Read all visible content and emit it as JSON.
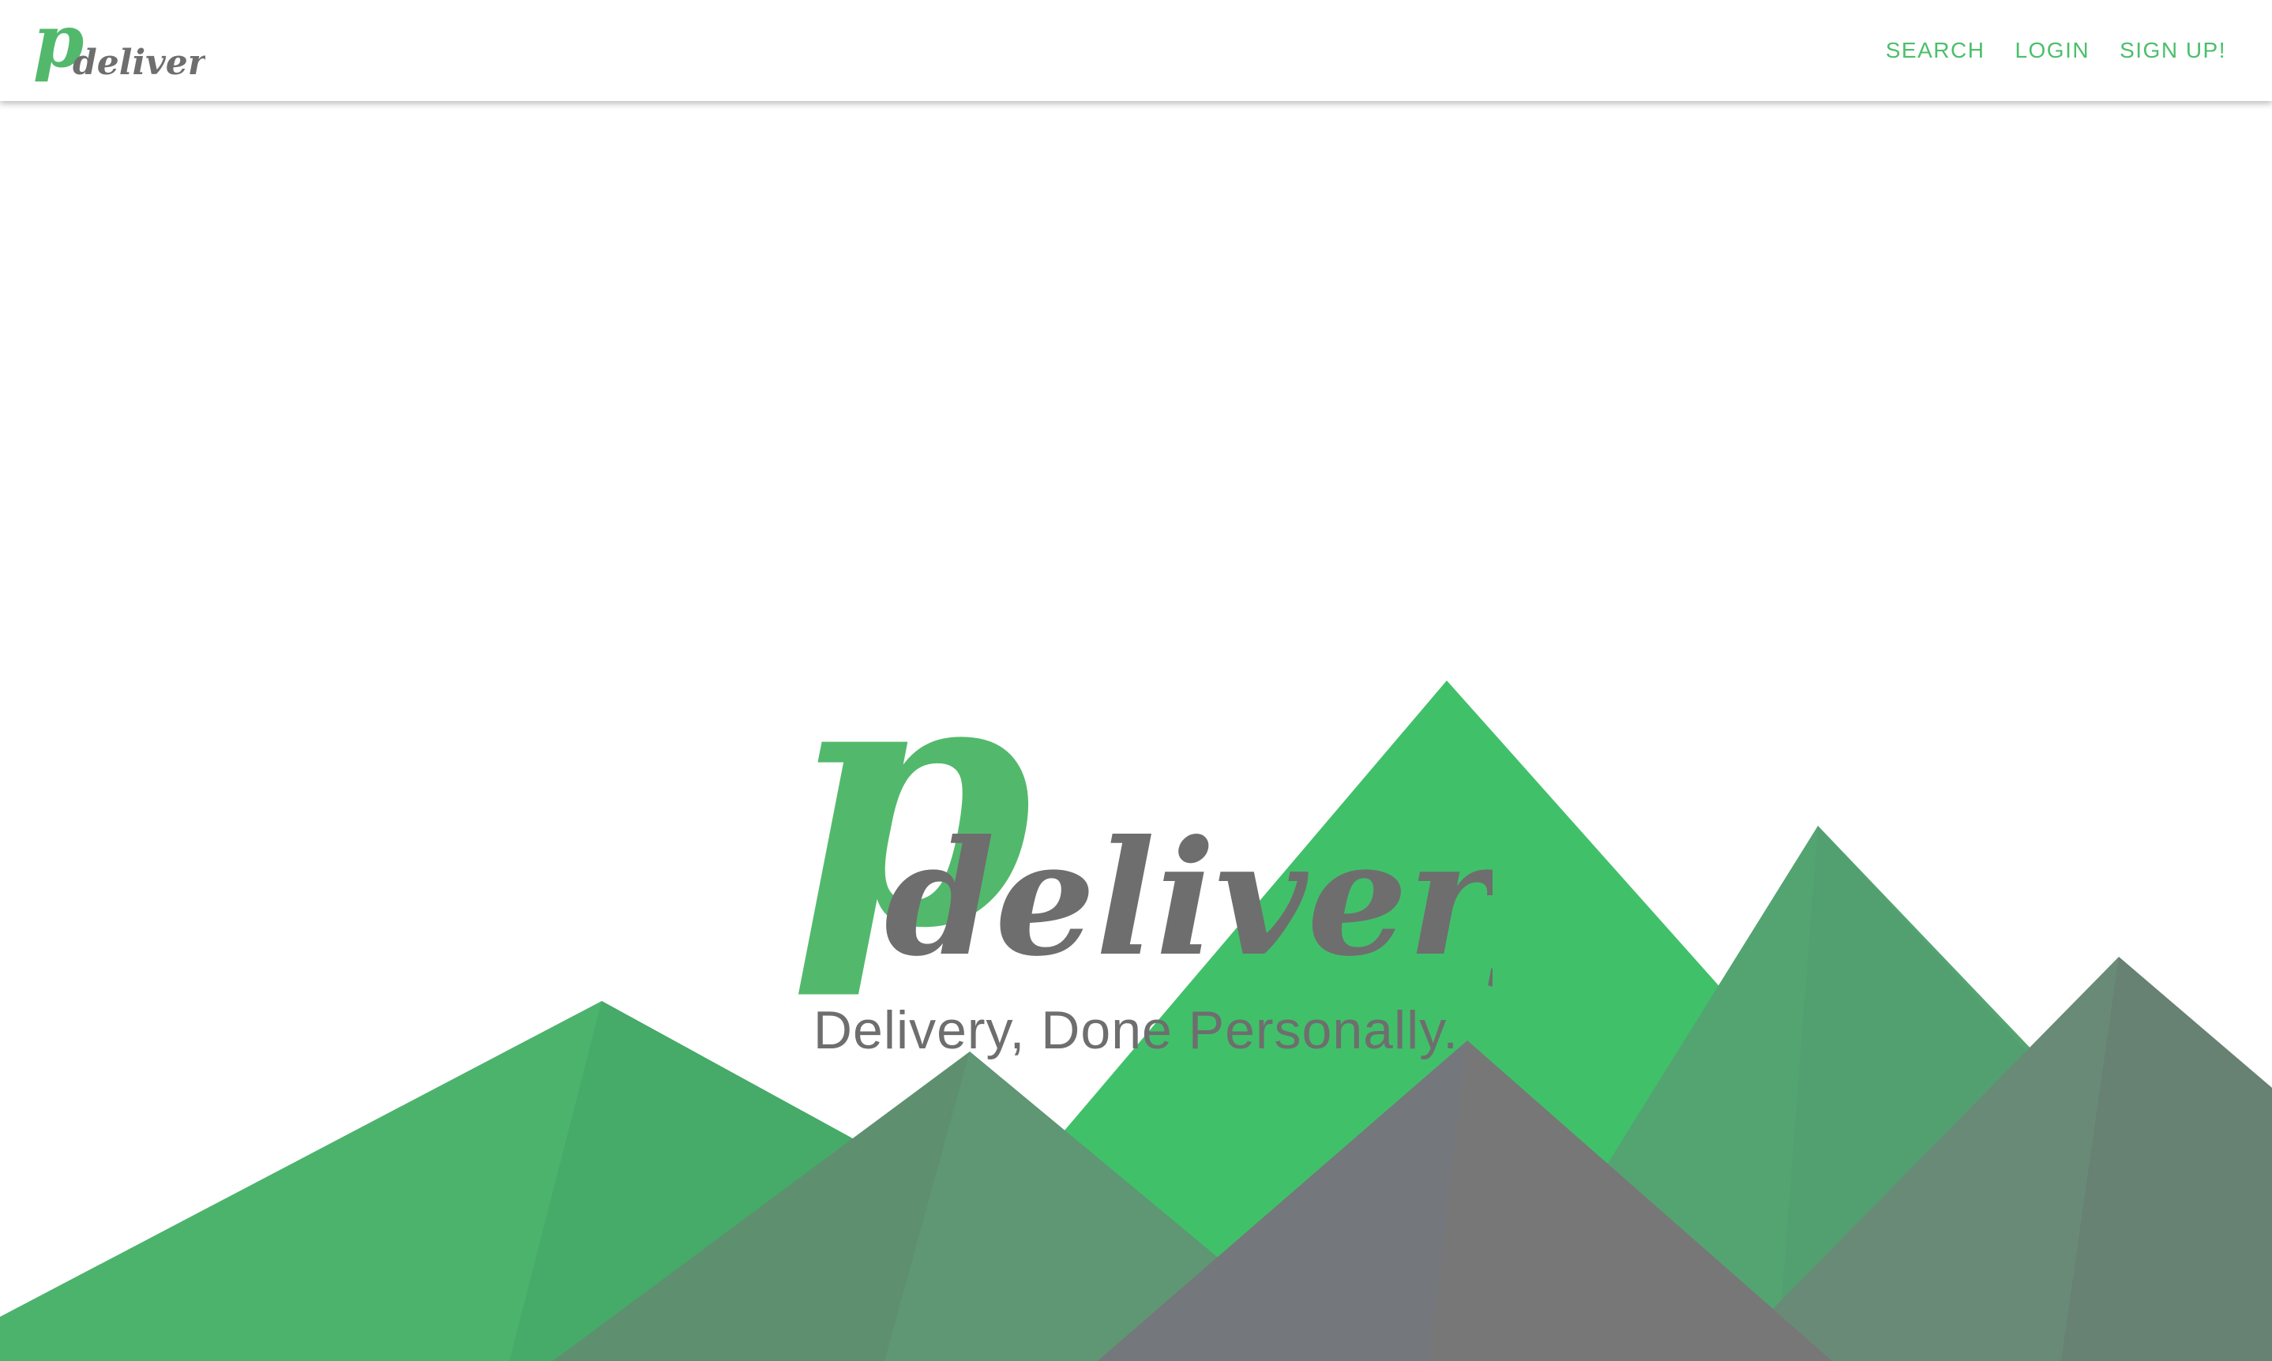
{
  "brand": {
    "logo_p": "p",
    "logo_text": "delivery",
    "green": "#52b96c",
    "gray": "#6e6e6e"
  },
  "nav": {
    "links": [
      {
        "label": "SEARCH"
      },
      {
        "label": "LOGIN"
      },
      {
        "label": "SIGN UP!"
      }
    ]
  },
  "hero": {
    "tagline": "Delivery, Done Personally."
  },
  "colors": {
    "accent": "#4bbf6b",
    "mountain_bright": "#41c06a",
    "mountain_mid": "#4baa6b",
    "mountain_muted": "#609476",
    "mountain_gray": "#737678"
  }
}
